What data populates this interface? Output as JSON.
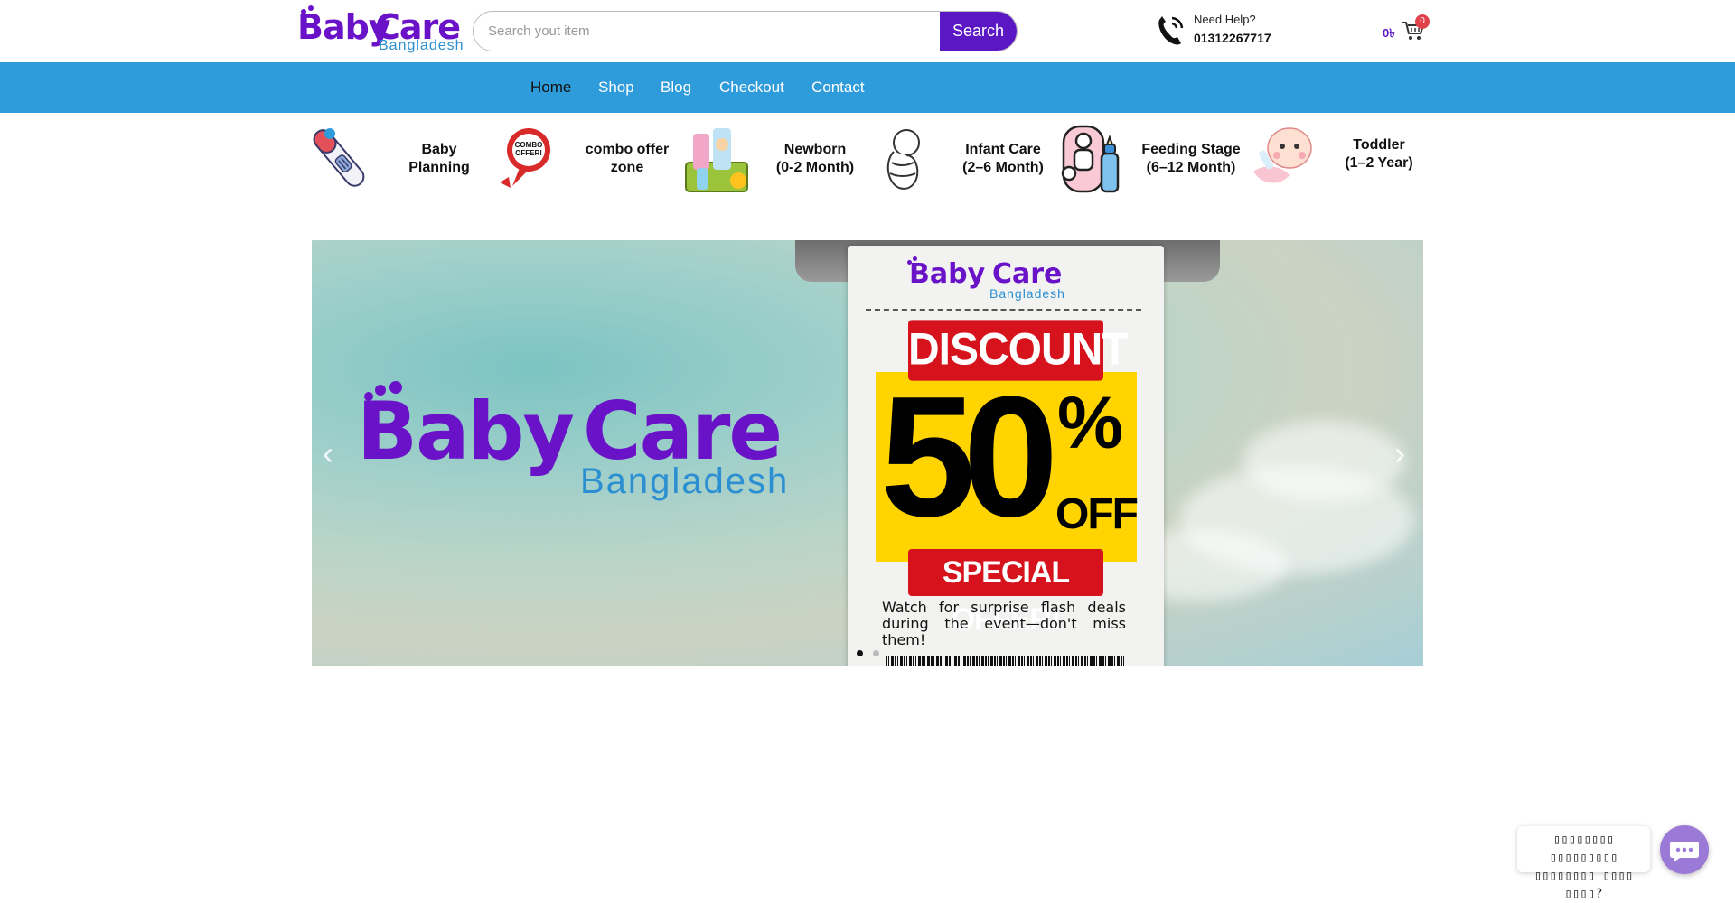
{
  "header": {
    "logo": {
      "word1": "Baby",
      "word2": "Care",
      "sub": "Bangladesh"
    },
    "search": {
      "placeholder": "Search yout item",
      "button_label": "Search"
    },
    "help": {
      "label": "Need Help?",
      "phone": "01312267717",
      "icon": "phone-icon"
    },
    "cart": {
      "amount": "0৳",
      "count": "0",
      "icon": "cart-icon"
    }
  },
  "nav": {
    "items": [
      {
        "label": "Home",
        "active": true
      },
      {
        "label": "Shop",
        "active": false
      },
      {
        "label": "Blog",
        "active": false
      },
      {
        "label": "Checkout",
        "active": false
      },
      {
        "label": "Contact",
        "active": false
      }
    ]
  },
  "categories": [
    {
      "label_line1": "Baby",
      "label_line2": "Planning",
      "icon": "pregnancy-test-icon"
    },
    {
      "label_line1": "combo offer",
      "label_line2": "zone",
      "icon": "combo-offer-icon"
    },
    {
      "label_line1": "Newborn",
      "label_line2": "(0-2 Month)",
      "icon": "baby-products-icon"
    },
    {
      "label_line1": "Infant Care",
      "label_line2": "(2–6 Month)",
      "icon": "newborn-icon"
    },
    {
      "label_line1": "Feeding Stage",
      "label_line2": "(6–12 Month)",
      "icon": "feeding-bottle-icon"
    },
    {
      "label_line1": "Toddler",
      "label_line2": "(1–2 Year)",
      "icon": "baby-face-icon"
    }
  ],
  "banner": {
    "logo": {
      "word1": "Baby",
      "word2": "Care",
      "sub": "Bangladesh"
    },
    "receipt": {
      "logo": {
        "word1": "Baby",
        "word2": "Care",
        "sub": "Bangladesh"
      },
      "discount": "DISCOUNT",
      "value": "50",
      "percent": "%",
      "off": "OFF",
      "special": "SPECIAL OFFER!",
      "note": "Watch for surprise flash deals during the event—don't miss them!"
    },
    "prev_icon": "chevron-left-icon",
    "next_icon": "chevron-right-icon",
    "slides_total": 2,
    "active_slide": 1
  },
  "chat": {
    "message_line1": "▯▯▯▯▯▯▯▯ ▯▯▯▯▯▯▯▯▯",
    "message_line2": "▯▯▯▯▯▯▯▯ ▯▯▯▯ ▯▯▯▯?",
    "icon": "chat-icon"
  },
  "colors": {
    "brand_purple": "#5c17c4",
    "nav_blue": "#2e9bdb",
    "logo_blue": "#2b8fd1",
    "badge_red": "#e0414a",
    "discount_red": "#d6121c",
    "offer_yellow": "#ffd400"
  }
}
